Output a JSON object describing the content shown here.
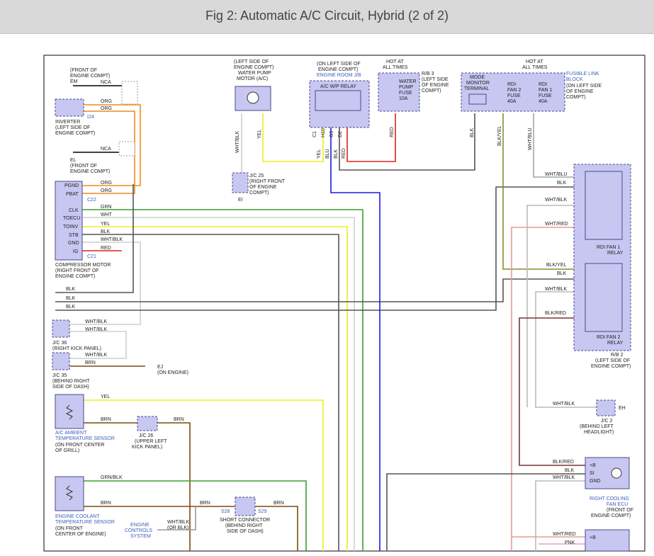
{
  "title": "Fig 2: Automatic A/C Circuit, Hybrid (2 of 2)",
  "labels": {
    "em_loc": [
      "(FRONT OF",
      "ENGINE COMPT)"
    ],
    "em": "EM",
    "nca": "NCA",
    "inverter": [
      "INVERTER",
      "(LEFT SIDE OF",
      "ENGINE COMPT)"
    ],
    "i24": "I24",
    "el": "EL",
    "el_loc": [
      "(FRONT OF",
      "ENGINE COMPT)"
    ],
    "pgnd": "PGND",
    "pbat": "PBAT",
    "c22": "C22",
    "clk": "CLK",
    "toecu": "TOECU",
    "toinv": "TOINV",
    "stb": "STB",
    "gnd": "GND",
    "ig": "IG",
    "c21": "C21",
    "compressor": [
      "COMPRESSOR MOTOR",
      "(RIGHT FRONT OF",
      "ENGINE COMPT)"
    ],
    "jc36": [
      "J/C 36",
      "(RIGHT KICK PANEL)"
    ],
    "jc35": [
      "J/C 35",
      "(BEHIND RIGHT",
      "SIDE OF DASH)"
    ],
    "ej": "EJ",
    "ej_loc": "(ON ENGINE)",
    "ambient": [
      "A/C AMBIENT",
      "TEMPERATURE SENSOR"
    ],
    "ambient_loc": [
      "(ON FRONT CENTER",
      "OF GRILL)"
    ],
    "jc26": [
      "J/C 26",
      "(UPPER LEFT",
      "KICK PANEL)"
    ],
    "coolant": [
      "ENGINE COOLANT",
      "TEMPERATURE SENSOR"
    ],
    "coolant_loc": [
      "(ON FRONT",
      "CENTER OF ENGINE)"
    ],
    "engine_controls": [
      "ENGINE",
      "CONTROLS",
      "SYSTEM"
    ],
    "wht_blk_or_blk": [
      "WHT/BLK",
      "(OR BLK)"
    ],
    "short_connector": [
      "SHORT CONNECTOR",
      "(BEHIND RIGHT",
      "SIDE OF DASH)"
    ],
    "s28": "S28",
    "s29": "S29",
    "water_pump_motor": [
      "(LEFT SIDE OF",
      "ENGINE COMPT)",
      "WATER PUMP",
      "MOTOR (A/C)"
    ],
    "jc25": [
      "J/C 25",
      "(RIGHT FRONT",
      "OF ENGINE",
      "COMPT)"
    ],
    "ei": "EI",
    "engine_room_jb_loc": [
      "(ON LEFT SIDE OF",
      "ENGINE COMPT)"
    ],
    "engine_room_jb": "ENGINE ROOM J/B",
    "ac_wp_relay": "A/C W/P RELAY",
    "hot_at_all_times": [
      "HOT AT",
      "ALL TIMES"
    ],
    "rb3": [
      "R/B 3",
      "(LEFT SIDE",
      "OF ENGINE",
      "COMPT)"
    ],
    "water_pump_fuse": [
      "WATER",
      "PUMP",
      "FUSE",
      "10A"
    ],
    "mode_monitor": [
      "MODE",
      "MONITOR",
      "TERMINAL"
    ],
    "rdi_fan2_fuse": [
      "RDI",
      "FAN 2",
      "FUSE",
      "40A"
    ],
    "rdi_fan1_fuse": [
      "RDI",
      "FAN 1",
      "FUSE",
      "40A"
    ],
    "fusible_link_block": [
      "FUSIBLE LINK",
      "BLOCK"
    ],
    "fusible_link_loc": [
      "(ON LEFT SIDE",
      "OF ENGINE",
      "COMPT)"
    ],
    "rdi_fan1_relay": [
      "RDI FAN 1",
      "RELAY"
    ],
    "rdi_fan2_relay": [
      "RDI FAN 2",
      "RELAY"
    ],
    "rb2": [
      "R/B 2",
      "(LEFT SIDE OF",
      "ENGINE COMPT)"
    ],
    "jc2": [
      "J/C 2",
      "(BEHIND LEFT",
      "HEADLIGHT)"
    ],
    "eh": "EH",
    "rdi_cooling_fan_ecu": [
      "RIGHT COOLING",
      "FAN ECU"
    ],
    "rdi_cooling_fan_loc": [
      "(FRONT OF",
      "ENGINE COMPT)"
    ],
    "plus_b": "+B",
    "si": "SI",
    "gnd_ecu": "GND"
  },
  "connector_ids": {
    "c1": "C1",
    "h10": "H10",
    "g5": "G5",
    "d2": "D2"
  },
  "wire_colors": {
    "org": "ORG",
    "grn": "GRN",
    "wht": "WHT",
    "yel": "YEL",
    "blk": "BLK",
    "wht_blk": "WHT/BLK",
    "red": "RED",
    "brn": "BRN",
    "grn_blk": "GRN/BLK",
    "blu": "BLU",
    "wht_blu": "WHT/BLU",
    "wht_red": "WHT/RED",
    "blk_yel": "BLK/YEL",
    "blk_red": "BLK/RED",
    "pnk": "PNK"
  },
  "colors": {
    "orange": "#f08a1d",
    "green": "#3a9e2e",
    "yellow": "#eded1e",
    "red": "#e02020",
    "blue": "#1a1ae0",
    "brown": "#7a4a10",
    "gray": "#555555",
    "light_gray": "#b8b8b8",
    "salmon": "#e89a9a",
    "olive": "#8a8a2a",
    "label_blue": "#3b5fc0"
  }
}
